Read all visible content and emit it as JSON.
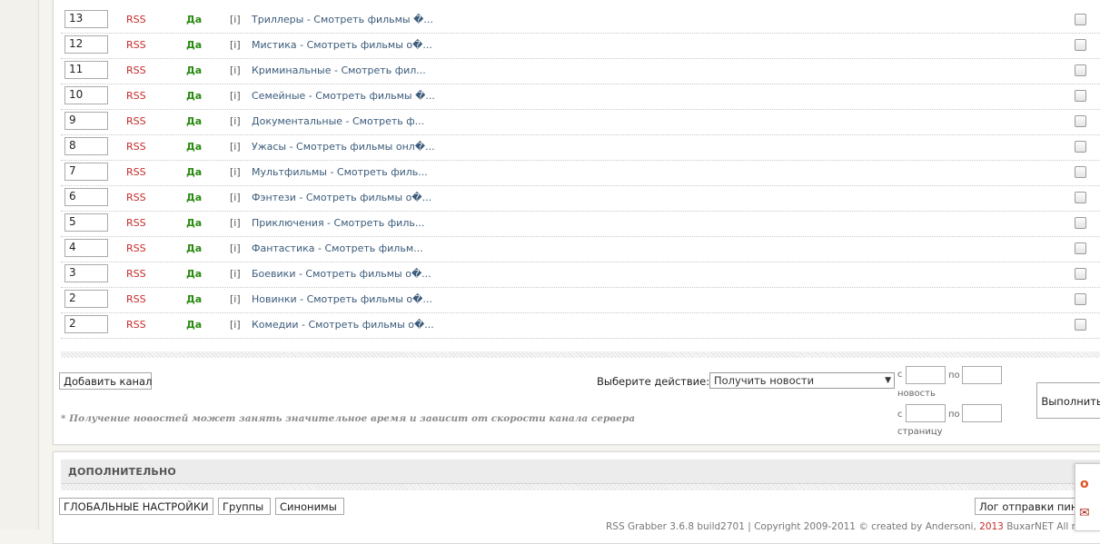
{
  "rows": [
    {
      "num": "13",
      "type": "RSS",
      "active": "Да",
      "info": "[i]",
      "title": "Триллеры - Смотреть фильмы �..."
    },
    {
      "num": "12",
      "type": "RSS",
      "active": "Да",
      "info": "[i]",
      "title": "Мистика - Смотреть фильмы о�..."
    },
    {
      "num": "11",
      "type": "RSS",
      "active": "Да",
      "info": "[i]",
      "title": "Криминальные - Смотреть фил..."
    },
    {
      "num": "10",
      "type": "RSS",
      "active": "Да",
      "info": "[i]",
      "title": "Семейные - Смотреть фильмы �..."
    },
    {
      "num": "9",
      "type": "RSS",
      "active": "Да",
      "info": "[i]",
      "title": "Документальные - Смотреть ф..."
    },
    {
      "num": "8",
      "type": "RSS",
      "active": "Да",
      "info": "[i]",
      "title": "Ужасы - Смотреть фильмы онл�..."
    },
    {
      "num": "7",
      "type": "RSS",
      "active": "Да",
      "info": "[i]",
      "title": "Мультфильмы - Смотреть филь..."
    },
    {
      "num": "6",
      "type": "RSS",
      "active": "Да",
      "info": "[i]",
      "title": "Фэнтези - Смотреть фильмы о�..."
    },
    {
      "num": "5",
      "type": "RSS",
      "active": "Да",
      "info": "[i]",
      "title": "Приключения - Смотреть филь..."
    },
    {
      "num": "4",
      "type": "RSS",
      "active": "Да",
      "info": "[i]",
      "title": "Фантастика - Смотреть фильм..."
    },
    {
      "num": "3",
      "type": "RSS",
      "active": "Да",
      "info": "[i]",
      "title": "Боевики - Смотреть фильмы о�..."
    },
    {
      "num": "2",
      "type": "RSS",
      "active": "Да",
      "info": "[i]",
      "title": "Новинки - Смотреть фильмы о�..."
    },
    {
      "num": "2",
      "type": "RSS",
      "active": "Да",
      "info": "[i]",
      "title": "Комедии - Смотреть фильмы о�..."
    }
  ],
  "actions": {
    "add_channel": "Добавить канал",
    "select_label": "Выберите действие:",
    "select_value": "Получить новости",
    "from_label": "с",
    "to_label": "по",
    "news_label": "новость",
    "page_label": "страницу",
    "execute": "Выполнить",
    "note": "* Получение новостей может занять значительное время и зависит от скорости канала сервера"
  },
  "extra": {
    "heading": "ДОПОЛНИТЕЛЬНО",
    "global_settings": "ГЛОБАЛЬНЫЕ НАСТРОЙКИ",
    "groups": "Группы",
    "synonyms": "Синонимы",
    "ping_log": "Лог отправки пин"
  },
  "footer": {
    "text_a": "RSS Grabber 3.6.8 build2701 | Copyright 2009-2011 © created by Andersoni, ",
    "text_red": "2013",
    "text_b": " BuxarNET All rights res"
  },
  "colors": {
    "rss": "#c62a2a",
    "yes": "#2a8a12",
    "link": "#3b5b7a"
  }
}
